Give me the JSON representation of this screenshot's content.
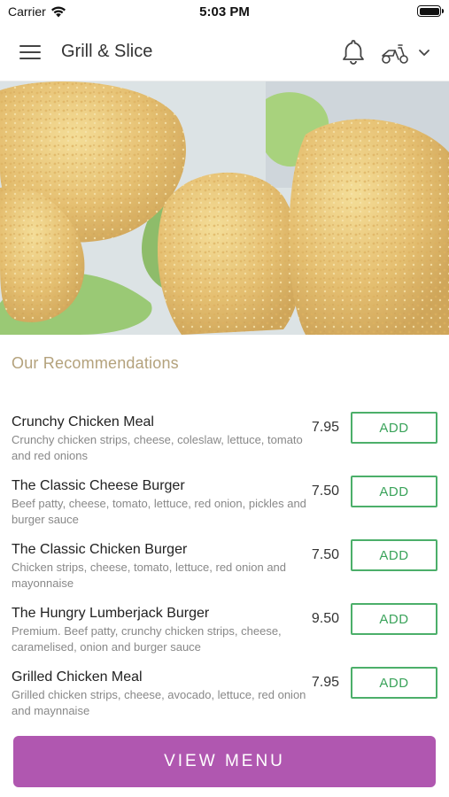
{
  "status_bar": {
    "carrier": "Carrier",
    "time": "5:03 PM"
  },
  "nav": {
    "title": "Grill & Slice",
    "icons": [
      "menu-icon",
      "bell-icon",
      "scooter-icon",
      "chevron-down-icon"
    ]
  },
  "hero": {
    "image": "crispy-fried-chicken-on-lettuce"
  },
  "recommendations": {
    "title": "Our Recommendations",
    "items": [
      {
        "name": "Crunchy Chicken Meal",
        "description": "Crunchy chicken strips, cheese, coleslaw, lettuce, tomato and red onions",
        "price": "7.95",
        "add_label": "ADD"
      },
      {
        "name": "The Classic Cheese Burger",
        "description": "Beef patty, cheese, tomato, lettuce, red onion, pickles and burger sauce",
        "price": "7.50",
        "add_label": "ADD"
      },
      {
        "name": "The Classic Chicken Burger",
        "description": "Chicken strips, cheese, tomato, lettuce, red onion and mayonnaise",
        "price": "7.50",
        "add_label": "ADD"
      },
      {
        "name": "The Hungry Lumberjack Burger",
        "description": "Premium. Beef patty, crunchy chicken strips, cheese, caramelised, onion and burger sauce",
        "price": "9.50",
        "add_label": "ADD"
      },
      {
        "name": "Grilled Chicken Meal",
        "description": "Grilled chicken strips, cheese, avocado, lettuce, red onion and maynnaise",
        "price": "7.95",
        "add_label": "ADD"
      }
    ]
  },
  "footer": {
    "view_menu_label": "VIEW MENU"
  },
  "colors": {
    "accent": "#b057b0",
    "add_button": "#4caf6a",
    "section_title": "#b4a27c"
  }
}
